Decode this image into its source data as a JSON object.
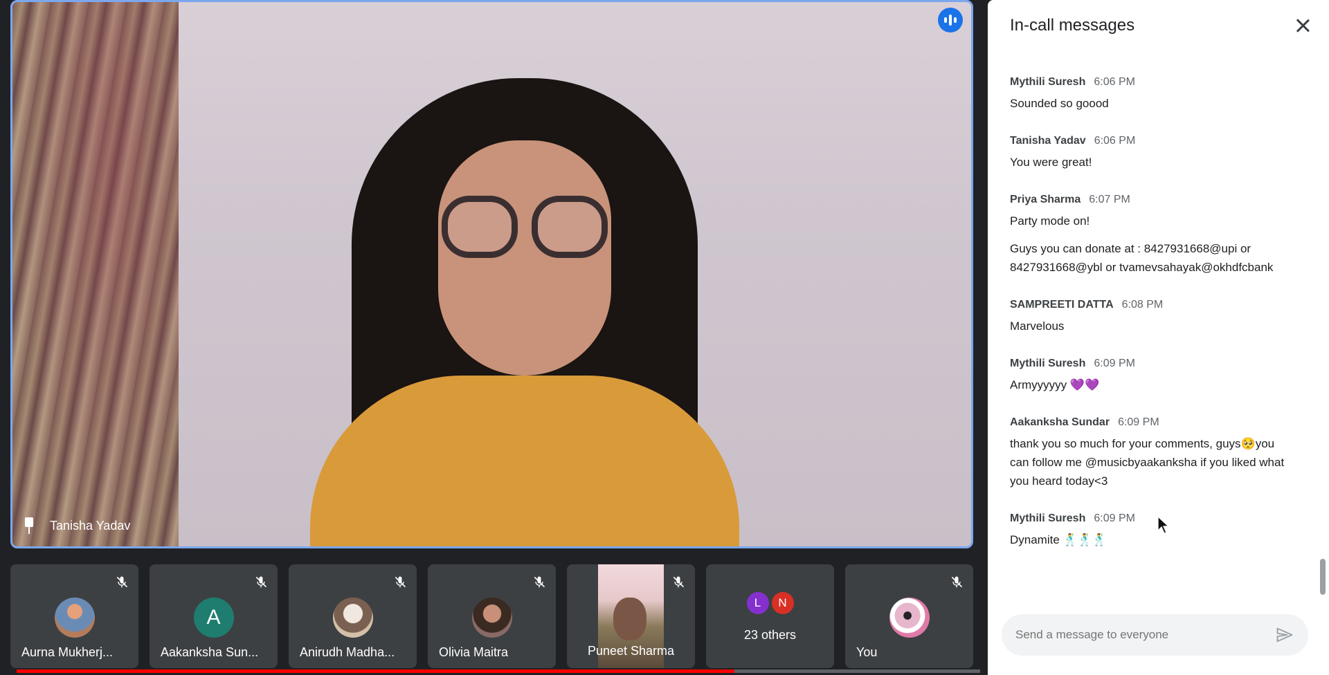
{
  "main_video": {
    "speaker_name": "Tanisha Yadav",
    "pin_icon": "pin-icon",
    "speaking_indicator_icon": "audio-wave-icon"
  },
  "participants": [
    {
      "name": "Aurna Mukherj...",
      "avatar": "photo",
      "muted": true
    },
    {
      "name": "Aakanksha Sun...",
      "avatar": "A",
      "avatar_color": "#1e7d6f",
      "muted": true
    },
    {
      "name": "Anirudh Madha...",
      "avatar": "photo",
      "muted": true
    },
    {
      "name": "Olivia Maitra",
      "avatar": "photo",
      "muted": true
    },
    {
      "name": "Puneet Sharma",
      "avatar": "video",
      "muted": true
    },
    {
      "name": "23 others",
      "mini_avatars": [
        {
          "letter": "L",
          "color": "#8430ce"
        },
        {
          "letter": "N",
          "color": "#d93025"
        }
      ]
    },
    {
      "name": "You",
      "avatar": "photo",
      "muted": true
    }
  ],
  "chat": {
    "title": "In-call messages",
    "close_icon": "close-icon",
    "messages": [
      {
        "sender": "Mythili Suresh",
        "time": "6:06 PM",
        "lines": [
          "Sounded so goood"
        ]
      },
      {
        "sender": "Tanisha Yadav",
        "time": "6:06 PM",
        "lines": [
          "You were great!"
        ]
      },
      {
        "sender": "Priya Sharma",
        "time": "6:07 PM",
        "lines": [
          "Party mode on!",
          "Guys you can donate at : 8427931668@upi or",
          "8427931668@ybl or tvamevsahayak@okhdfcbank"
        ]
      },
      {
        "sender": "SAMPREETI DATTA",
        "time": "6:08 PM",
        "lines": [
          "Marvelous"
        ]
      },
      {
        "sender": "Mythili Suresh",
        "time": "6:09 PM",
        "lines": [
          "Armyyyyyy 💜💜"
        ]
      },
      {
        "sender": "Aakanksha Sundar",
        "time": "6:09 PM",
        "lines": [
          "thank you so much for your comments, guys🥺you",
          "can follow me @musicbyaakanksha if you liked what",
          "you heard today<3"
        ]
      },
      {
        "sender": "Mythili Suresh",
        "time": "6:09 PM",
        "lines": [
          "Dynamite 🕺🕺🕺"
        ]
      }
    ],
    "input_placeholder": "Send a message to everyone",
    "send_icon": "send-icon"
  },
  "video_progress": 0.745,
  "colors": {
    "accent": "#1a73e8",
    "tile_border": "#7aa7ee",
    "progress": "#ff0000",
    "background": "#202124"
  }
}
